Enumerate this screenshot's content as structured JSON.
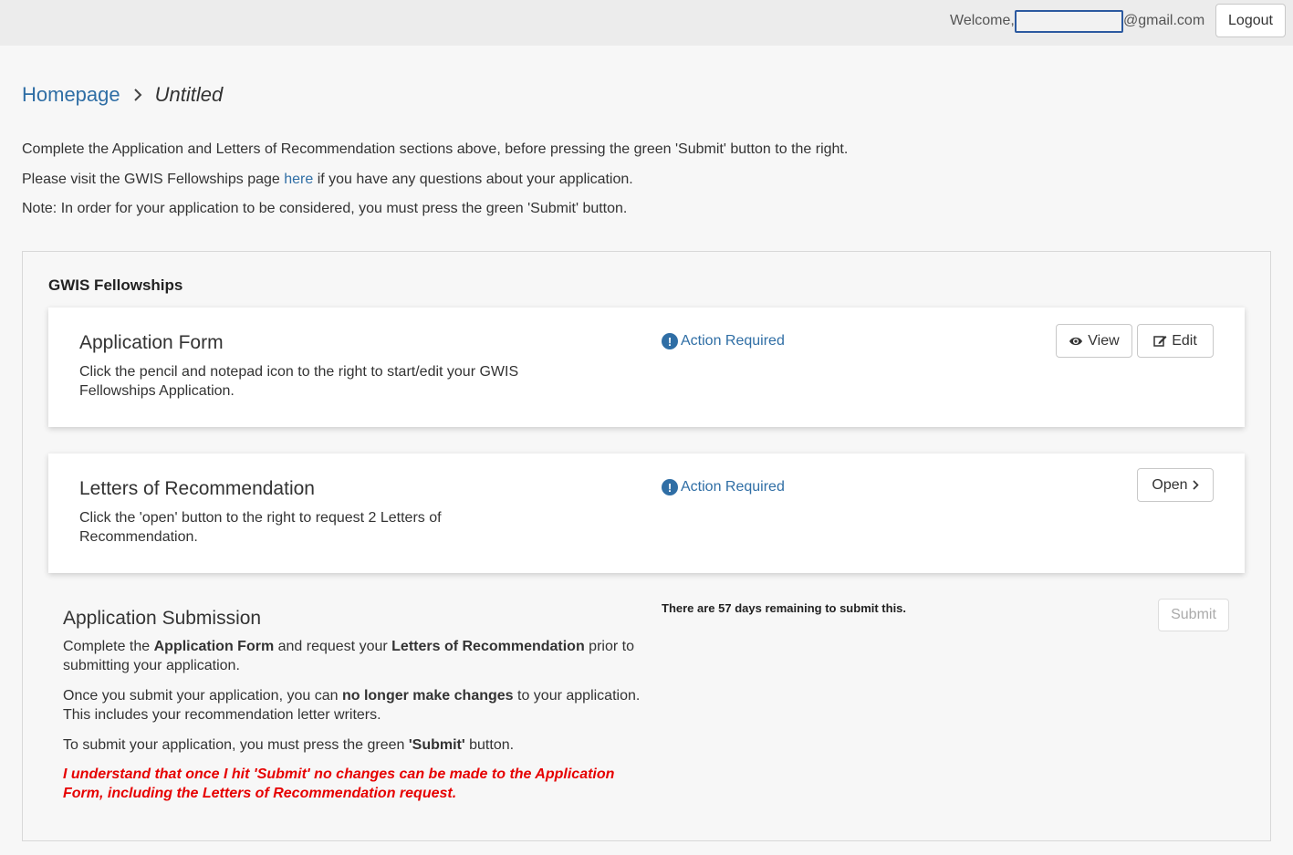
{
  "header": {
    "welcome_label": "Welcome,",
    "email_domain": "@gmail.com",
    "logout_label": "Logout"
  },
  "breadcrumb": {
    "home": "Homepage",
    "current": "Untitled"
  },
  "intro": {
    "line1": "Complete the Application and Letters of Recommendation sections above, before pressing the green 'Submit' button to the right.",
    "line2_before": "Please visit the GWIS Fellowships page ",
    "line2_link": "here",
    "line2_after": " if you have any questions about your application.",
    "line3": "Note: In order for your application to be considered, you must press the green 'Submit' button."
  },
  "panel": {
    "title": "GWIS Fellowships",
    "application_form": {
      "title": "Application Form",
      "description": "Click the pencil and notepad icon to the right to start/edit your GWIS Fellowships Application.",
      "status": "Action Required",
      "view_label": "View",
      "edit_label": "Edit"
    },
    "letters": {
      "title": "Letters of Recommendation",
      "description": "Click the 'open' button to the right to request 2 Letters of Recommendation.",
      "status": "Action Required",
      "open_label": "Open"
    },
    "submission": {
      "title": "Application Submission",
      "p1_a": "Complete the ",
      "p1_b": "Application Form",
      "p1_c": " and request your ",
      "p1_d": "Letters of Recommendation",
      "p1_e": " prior to submitting your application.",
      "p2_a": "Once you submit your application, you can ",
      "p2_b": "no longer make changes",
      "p2_c": " to your application. This includes your recommendation letter writers.",
      "p3_a": "To submit your application, you must press the green ",
      "p3_b": "'Submit'",
      "p3_c": " button.",
      "warning": "I understand that once I hit 'Submit' no changes can be made to the Application Form, including the Letters of Recommendation request.",
      "remaining": "There are 57 days remaining to submit this.",
      "submit_label": "Submit"
    }
  },
  "colors": {
    "link": "#2f6ea5",
    "warning": "#e60000",
    "topbar": "#ececec"
  }
}
